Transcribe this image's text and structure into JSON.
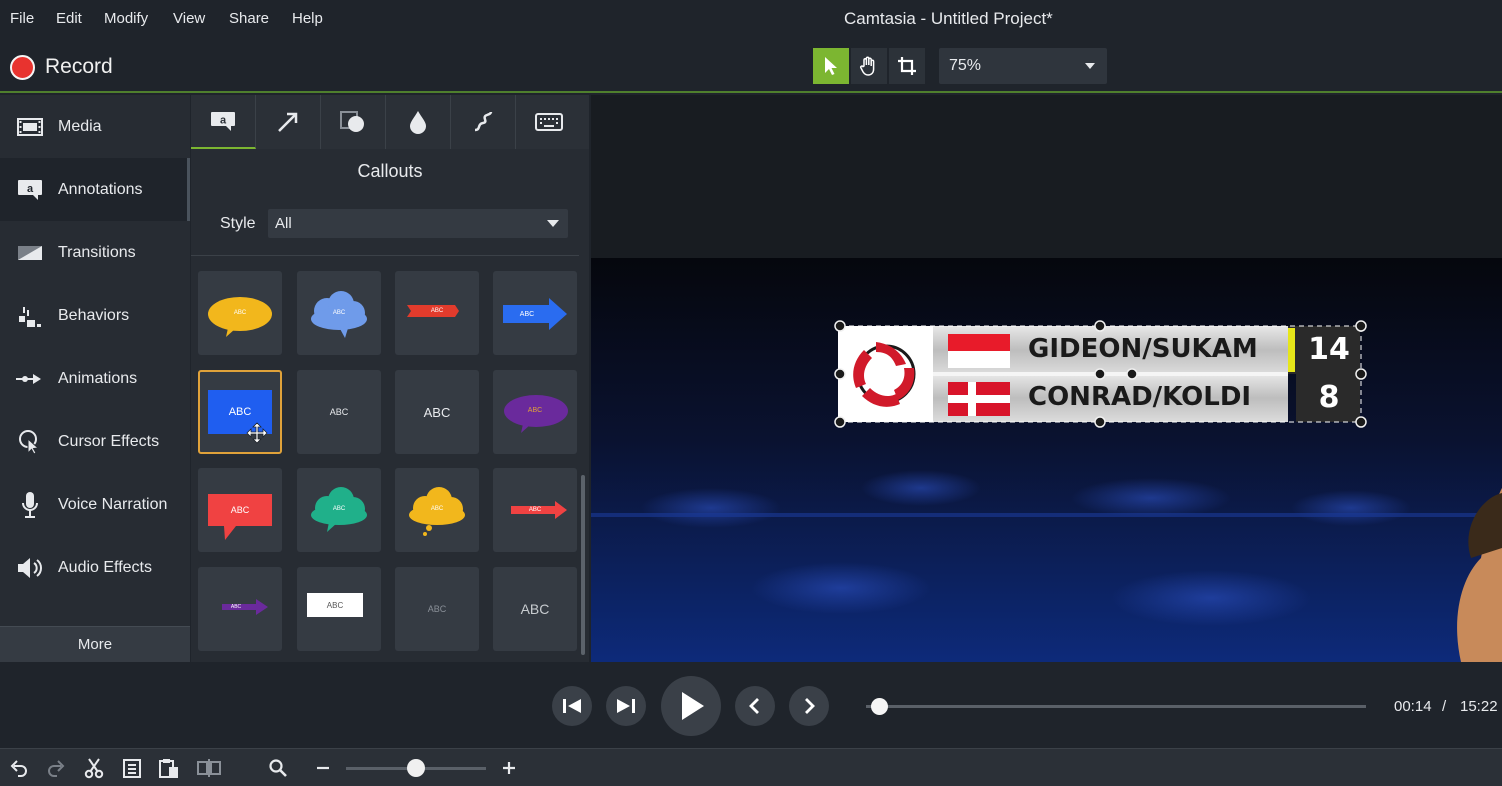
{
  "window": {
    "title": "Camtasia - Untitled Project*"
  },
  "menu": [
    "File",
    "Edit",
    "Modify",
    "View",
    "Share",
    "Help"
  ],
  "toolbar": {
    "record_label": "Record",
    "zoom_value": "75%"
  },
  "sidebar": {
    "items": [
      {
        "label": "Media",
        "icon": "film-icon"
      },
      {
        "label": "Annotations",
        "icon": "annotation-icon"
      },
      {
        "label": "Transitions",
        "icon": "transition-icon"
      },
      {
        "label": "Behaviors",
        "icon": "behaviors-icon"
      },
      {
        "label": "Animations",
        "icon": "animation-icon"
      },
      {
        "label": "Cursor Effects",
        "icon": "cursor-icon"
      },
      {
        "label": "Voice Narration",
        "icon": "microphone-icon"
      },
      {
        "label": "Audio Effects",
        "icon": "speaker-icon"
      }
    ],
    "more_label": "More"
  },
  "panel": {
    "title": "Callouts",
    "style_label": "Style",
    "style_value": "All",
    "callout_text": "ABC"
  },
  "canvas": {
    "scoreboard": {
      "rows": [
        {
          "team": "GIDEON/SUKAM",
          "score": "14",
          "flag": "indonesia"
        },
        {
          "team": "CONRAD/KOLDI",
          "score": "8",
          "flag": "denmark"
        }
      ]
    }
  },
  "playback": {
    "current_time": "00:14",
    "separator": "/",
    "total_time": "15:22"
  },
  "colors": {
    "accent": "#7cb631",
    "record": "#e8332f",
    "selected_tile": "#e0a23a"
  }
}
